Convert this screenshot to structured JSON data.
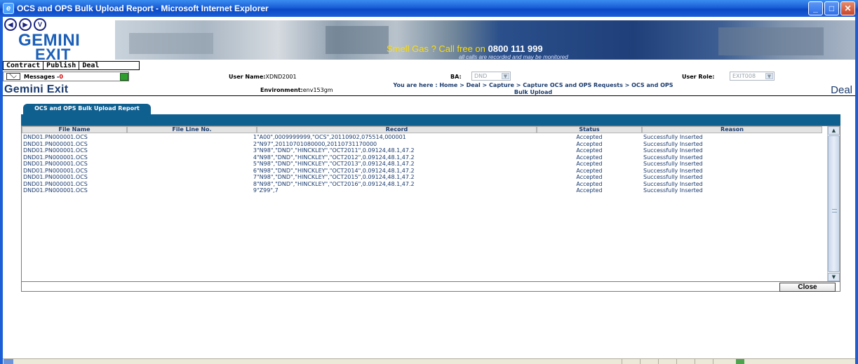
{
  "window": {
    "title": "OCS and OPS Bulk Upload Report - Microsoft Internet Explorer",
    "icon": "ie-icon",
    "buttons": [
      "minimize",
      "maximize",
      "close"
    ]
  },
  "banner": {
    "nav_circles": [
      "",
      "",
      "V"
    ],
    "logo_line1": "GEMINI",
    "logo_line2": "EXIT",
    "gas_text": "Smell Gas ? Call free on",
    "gas_number": "0800 111 999",
    "gas_subtext": "all calls are recorded and may be monitored"
  },
  "menu": {
    "items": [
      "Contract",
      "Publish",
      "Deal"
    ]
  },
  "info": {
    "messages_label": "Messages -",
    "messages_count": "0",
    "user_name_label": "User Name:",
    "user_name_value": "XDND2001",
    "ba_label": "BA:",
    "ba_value": "DND",
    "user_role_label": "User Role:",
    "user_role_value": "EXIT008"
  },
  "header": {
    "app_title": "Gemini Exit",
    "environment_label": "Environment:",
    "environment_value": "env153gm",
    "breadcrumb": "You are here : Home > Deal > Capture > Capture OCS and OPS Requests > OCS and OPS Bulk Upload",
    "section": "Deal"
  },
  "report": {
    "tab_label": "OCS and OPS Bulk Upload Report",
    "columns": [
      "File Name",
      "File Line No.",
      "Record",
      "Status",
      "Reason"
    ],
    "rows": [
      {
        "file": "DND01.PN000001.OCS",
        "line": "1",
        "record": "\"A00\",0009999999,\"OCS\",20110902,075514,000001",
        "status": "Accepted",
        "reason": "Successfully Inserted"
      },
      {
        "file": "DND01.PN000001.OCS",
        "line": "2",
        "record": "\"N97\",20110701080000,20110731170000",
        "status": "Accepted",
        "reason": "Successfully Inserted"
      },
      {
        "file": "DND01.PN000001.OCS",
        "line": "3",
        "record": "\"N98\",\"DND\",\"HINCKLEY\",\"OCT2011\",0.09124,48.1,47.2",
        "status": "Accepted",
        "reason": "Successfully Inserted"
      },
      {
        "file": "DND01.PN000001.OCS",
        "line": "4",
        "record": "\"N98\",\"DND\",\"HINCKLEY\",\"OCT2012\",0.09124,48.1,47.2",
        "status": "Accepted",
        "reason": "Successfully Inserted"
      },
      {
        "file": "DND01.PN000001.OCS",
        "line": "5",
        "record": "\"N98\",\"DND\",\"HINCKLEY\",\"OCT2013\",0.09124,48.1,47.2",
        "status": "Accepted",
        "reason": "Successfully Inserted"
      },
      {
        "file": "DND01.PN000001.OCS",
        "line": "6",
        "record": "\"N98\",\"DND\",\"HINCKLEY\",\"OCT2014\",0.09124,48.1,47.2",
        "status": "Accepted",
        "reason": "Successfully Inserted"
      },
      {
        "file": "DND01.PN000001.OCS",
        "line": "7",
        "record": "\"N98\",\"DND\",\"HINCKLEY\",\"OCT2015\",0.09124,48.1,47.2",
        "status": "Accepted",
        "reason": "Successfully Inserted"
      },
      {
        "file": "DND01.PN000001.OCS",
        "line": "8",
        "record": "\"N98\",\"DND\",\"HINCKLEY\",\"OCT2016\",0.09124,48.1,47.2",
        "status": "Accepted",
        "reason": "Successfully Inserted"
      },
      {
        "file": "DND01.PN000001.OCS",
        "line": "9",
        "record": "\"Z99\",7",
        "status": "Accepted",
        "reason": "Successfully Inserted"
      }
    ],
    "close_label": "Close"
  },
  "colors": {
    "titlebar": "#0b48c4",
    "accent": "#0f5f8f",
    "text_primary": "#1a3b6e",
    "message_count": "#d40000"
  }
}
